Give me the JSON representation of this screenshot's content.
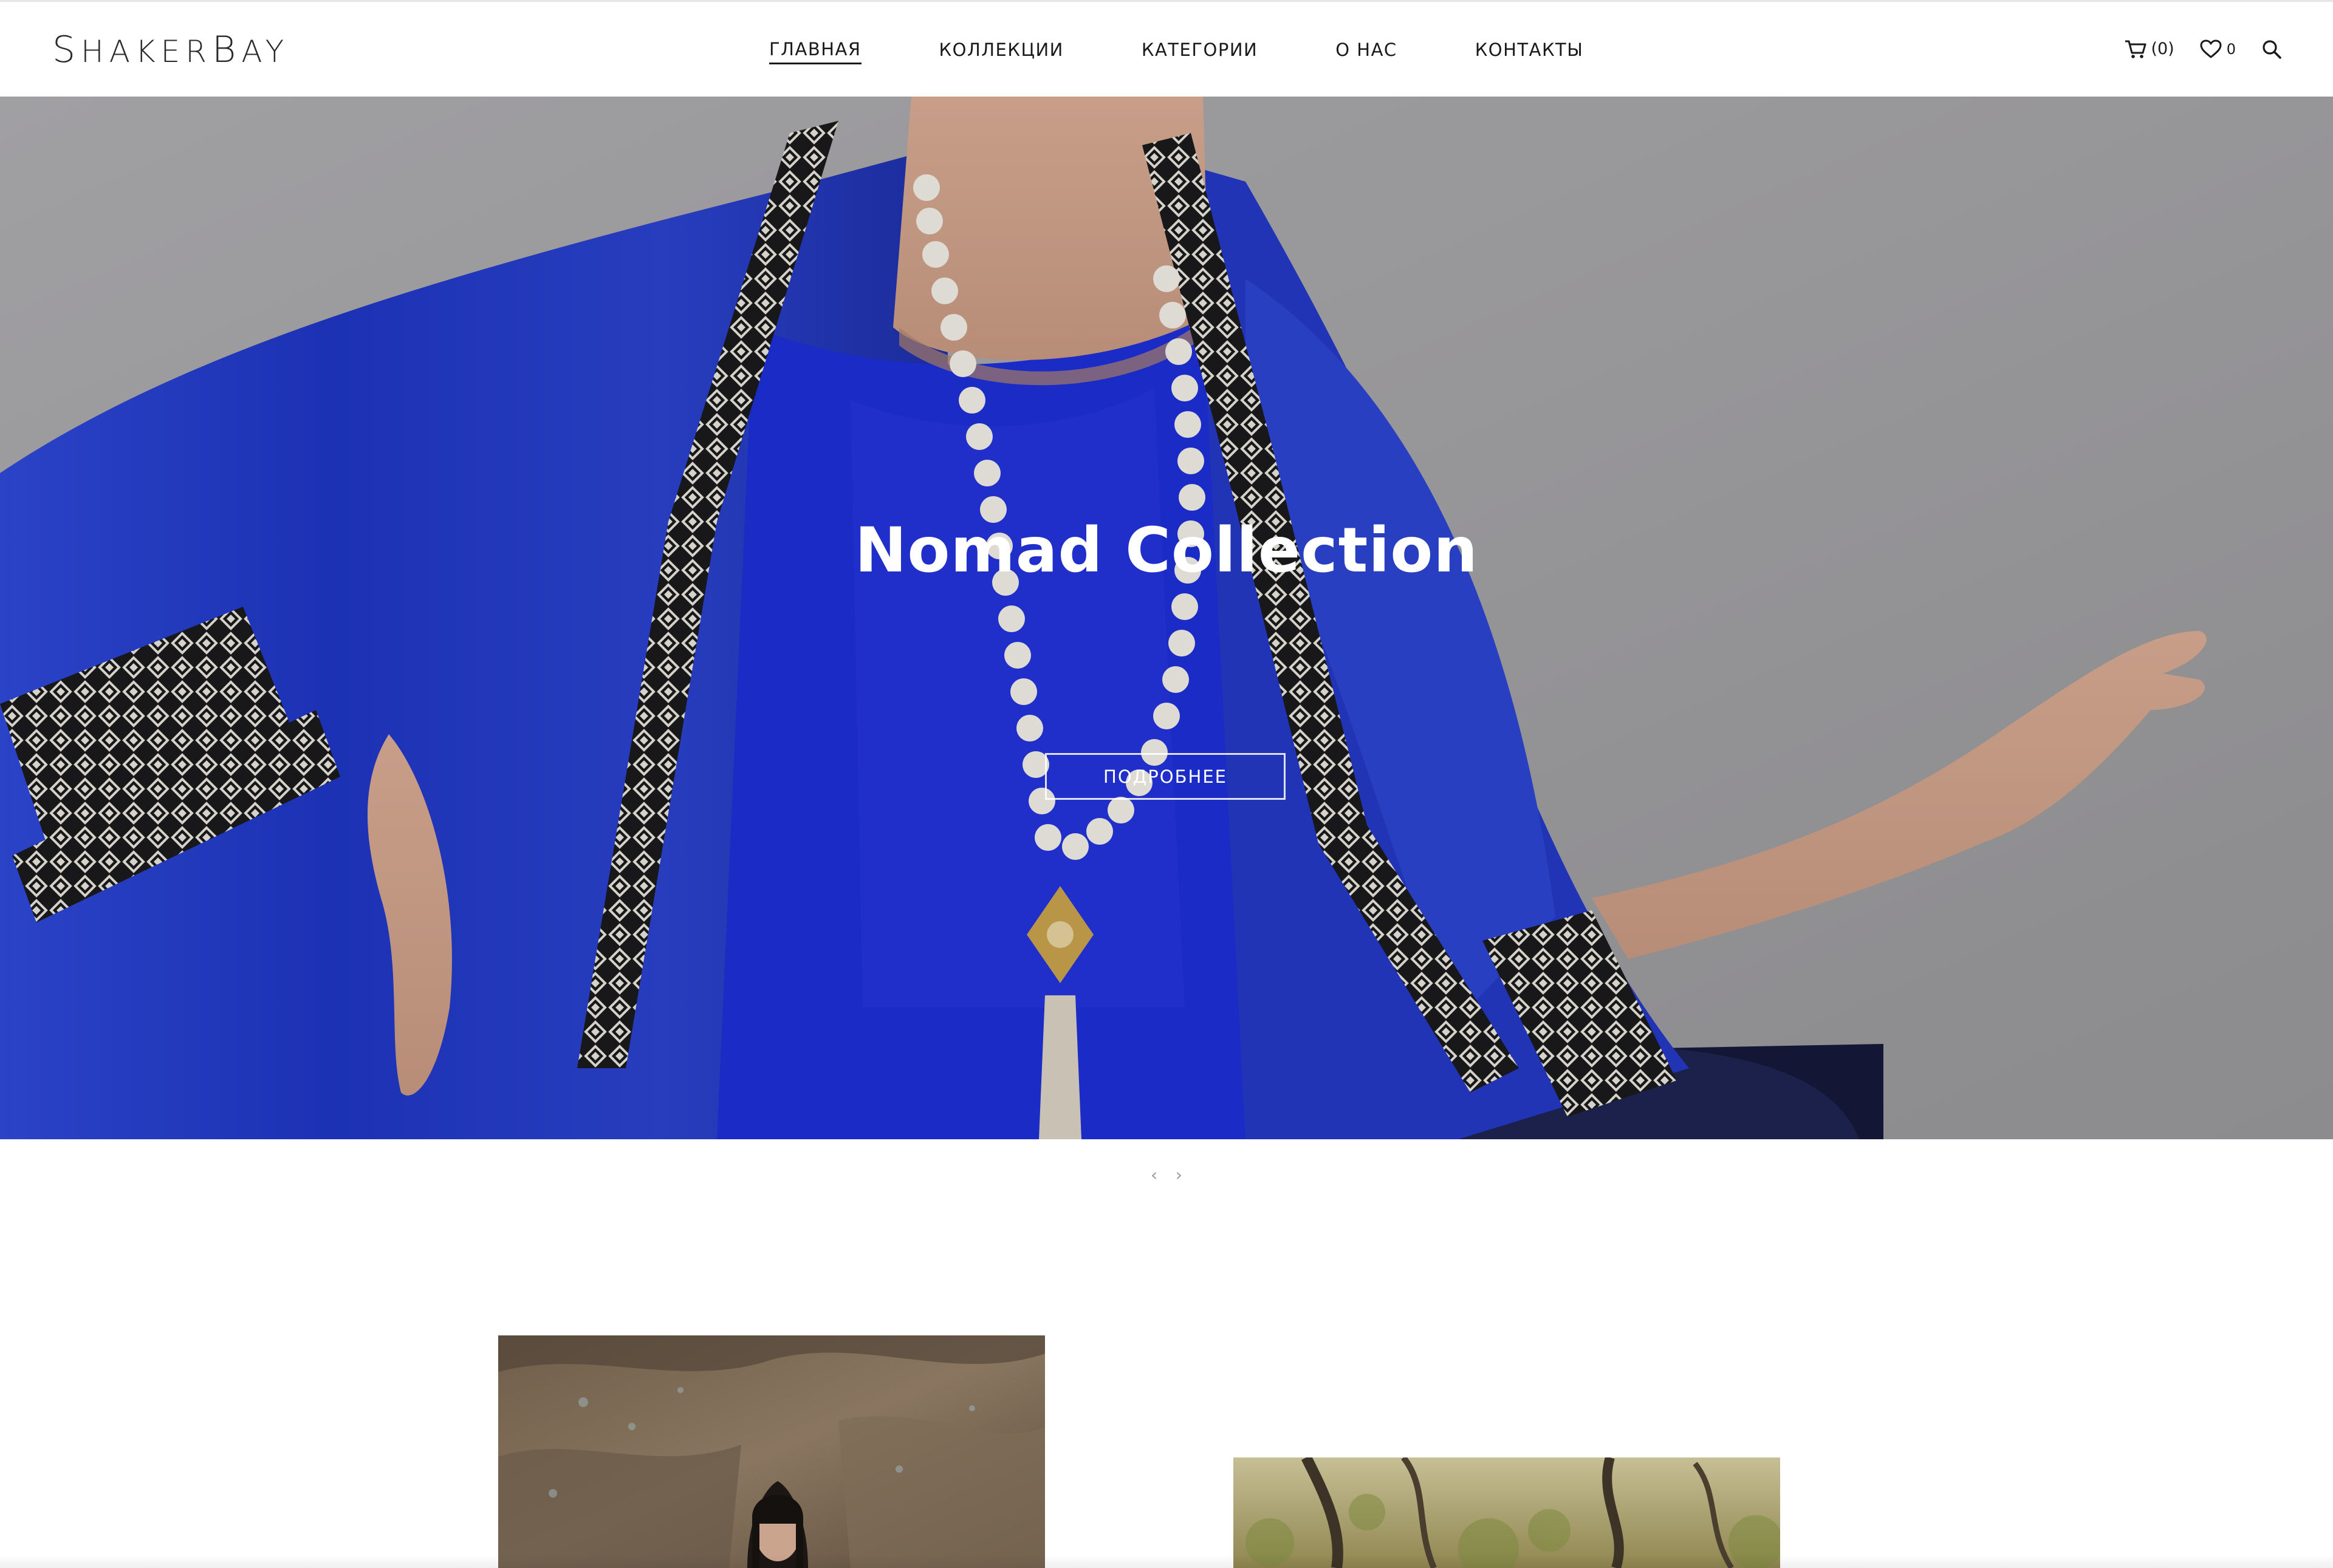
{
  "brand": {
    "logo": "ShakerBay"
  },
  "nav": {
    "items": [
      {
        "label": "ГЛАВНАЯ",
        "active": true
      },
      {
        "label": "КОЛЛЕКЦИИ",
        "active": false
      },
      {
        "label": "КАТЕГОРИИ",
        "active": false
      },
      {
        "label": "О НАС",
        "active": false
      },
      {
        "label": "КОНТАКТЫ",
        "active": false
      }
    ]
  },
  "tools": {
    "cart_count": "(0)",
    "wishlist_count": "0",
    "cart_icon": "cart-icon",
    "wishlist_icon": "heart-icon",
    "search_icon": "search-icon"
  },
  "hero": {
    "title": "Nomad Collection",
    "button_label": "ПОДРОБНЕЕ",
    "prev_arrow": "‹",
    "next_arrow": "›"
  },
  "colors": {
    "accent_blue": "#2a3fd1",
    "text": "#1a1a1a",
    "hero_backdrop": "#a2a1a3"
  }
}
